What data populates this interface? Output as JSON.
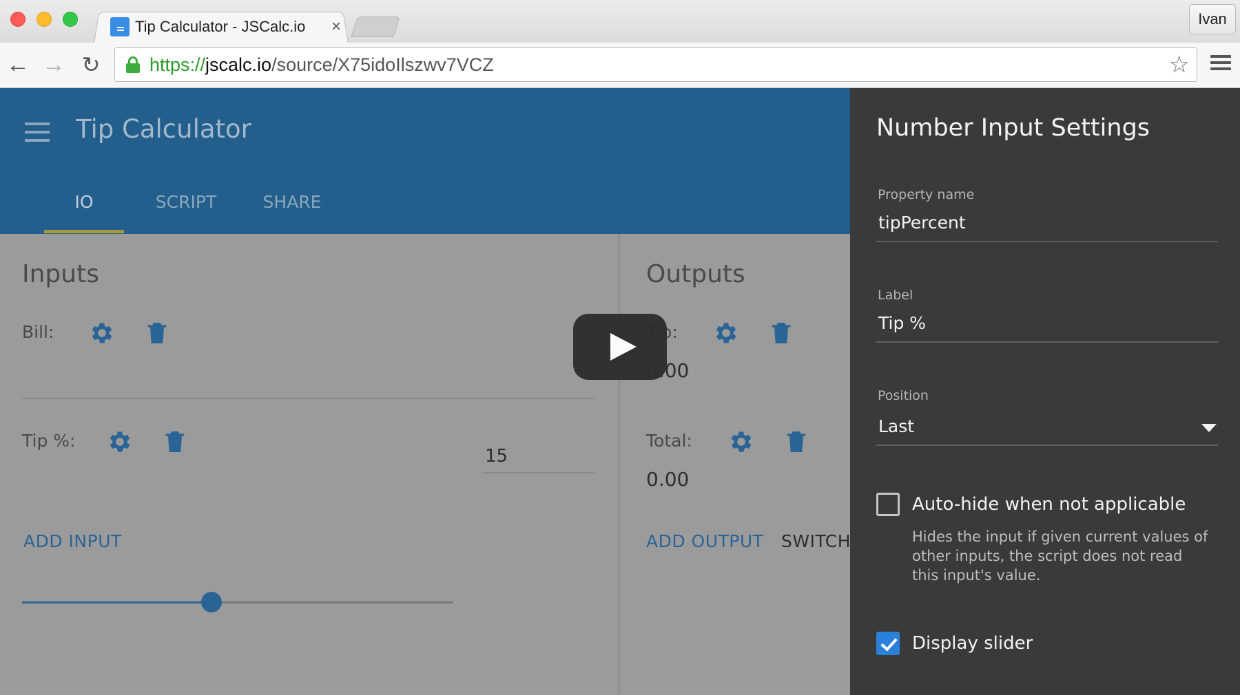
{
  "browser": {
    "tab_title": "Tip Calculator - JSCalc.io",
    "tab_close": "×",
    "profile_name": "Ivan",
    "url_scheme": "https://",
    "url_host": "jscalc.io",
    "url_path": "/source/X75idoIlszwv7VCZ",
    "back_glyph": "←",
    "forward_glyph": "→",
    "reload_glyph": "↻",
    "star_glyph": "☆",
    "icons": [
      "close-window-icon",
      "minimize-icon",
      "zoom-icon",
      "favicon-icon",
      "tab-close-icon",
      "back-arrow-icon",
      "forward-arrow-icon",
      "reload-icon",
      "lock-icon",
      "bookmark-star-icon",
      "chrome-menu-icon"
    ]
  },
  "app": {
    "title": "Tip Calculator",
    "tabs": [
      {
        "label": "IO",
        "active": true
      },
      {
        "label": "SCRIPT",
        "active": false
      },
      {
        "label": "SHARE",
        "active": false
      }
    ],
    "inputs": {
      "title": "Inputs",
      "bill_label": "Bill:",
      "tip_label": "Tip %:",
      "tip_value": "15",
      "tip_slider_fraction": 0.44,
      "add_button": "ADD INPUT"
    },
    "outputs": {
      "title": "Outputs",
      "tip_label": "Tip:",
      "tip_value": "0.00",
      "total_label": "Total:",
      "total_value": "0.00",
      "add_button": "ADD OUTPUT",
      "switch_button": "SWITCH"
    },
    "colors": {
      "appbar": "#235f8c",
      "accent": "#2a6496",
      "tab_indicator": "#a99a3e",
      "panel": "#3a3a3a",
      "checkbox_checked": "#2b80d9"
    }
  },
  "panel": {
    "title": "Number Input Settings",
    "property_name_label": "Property name",
    "property_name_value": "tipPercent",
    "label_label": "Label",
    "label_value": "Tip %",
    "position_label": "Position",
    "position_value": "Last",
    "autohide_label": "Auto-hide when not applicable",
    "autohide_checked": false,
    "autohide_help": "Hides the input if given current values of other inputs, the script does not read this input's value.",
    "slider_label": "Display slider",
    "slider_checked": true
  }
}
